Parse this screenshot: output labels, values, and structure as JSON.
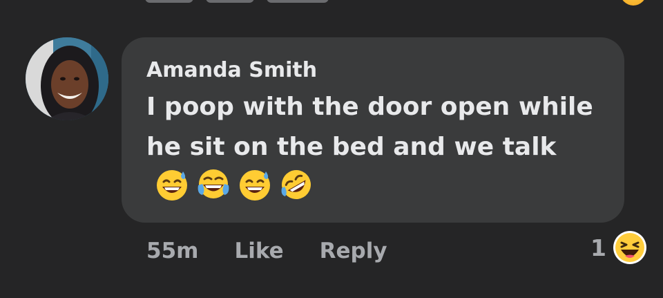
{
  "comment": {
    "author": "Amanda Smith",
    "text": "I poop with the door open while he sit on the bed and we talk",
    "emojis": [
      "sweat-smile-emoji",
      "tears-of-joy-emoji",
      "sweat-smile-emoji",
      "rolling-on-floor-laughing-emoji"
    ],
    "time": "55m",
    "like_label": "Like",
    "reply_label": "Reply",
    "reaction_count": "1",
    "reaction_icon": "haha-reaction-icon"
  },
  "colors": {
    "background": "#252526",
    "bubble": "#3a3b3c",
    "text": "#e8e9eb",
    "muted": "#a8aaae"
  }
}
